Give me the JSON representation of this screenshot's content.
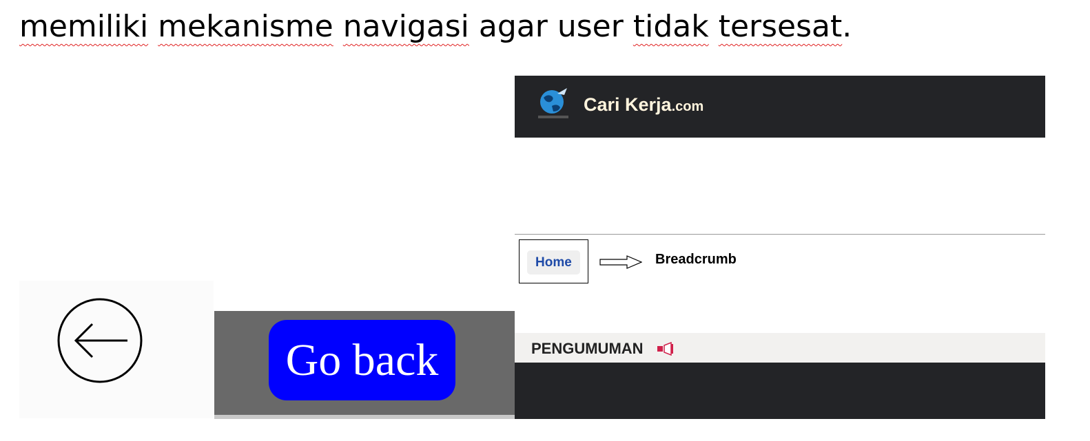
{
  "document": {
    "heading_words": [
      "memiliki",
      "mekanisme",
      "navigasi",
      "agar",
      "user",
      "tidak",
      "tersesat",
      "."
    ]
  },
  "back_icon": {
    "icon": "arrow-left-circle-icon"
  },
  "go_back": {
    "label": "Go back",
    "bg_color": "#0000ff"
  },
  "site": {
    "name": "Cari Kerja",
    "domain_suffix": ".com",
    "header_color": "#232427",
    "logo_icon": "globe-logo-icon"
  },
  "breadcrumb": {
    "home_label": "Home",
    "annotation": "Breadcrumb",
    "pointer_icon": "arrow-right-outline-icon"
  },
  "announcement": {
    "title": "PENGUMUMAN",
    "icon": "megaphone-icon"
  }
}
